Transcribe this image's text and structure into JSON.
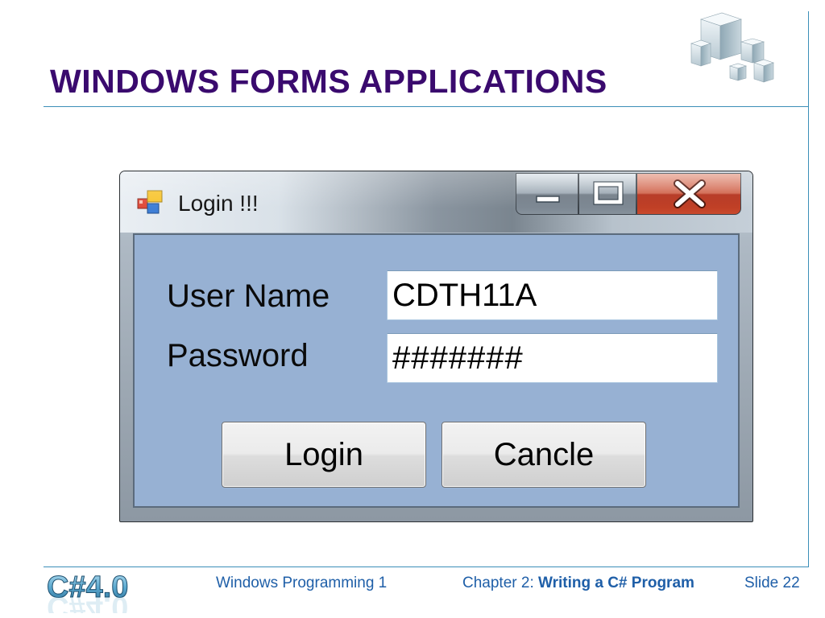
{
  "slide": {
    "title": "WINDOWS FORMS APPLICATIONS"
  },
  "window": {
    "title": "Login !!!",
    "icon": "winforms-app-icon",
    "controls": {
      "minimize_icon": "minimize-icon",
      "maximize_icon": "maximize-icon",
      "close_icon": "close-icon"
    },
    "form": {
      "username_label": "User Name",
      "username_value": "CDTH11A",
      "password_label": "Password",
      "password_value": "#######",
      "login_button": "Login",
      "cancel_button": "Cancle"
    },
    "colors": {
      "client_background": "#97b1d3",
      "close_button": "#c0392b"
    }
  },
  "footer": {
    "logo_text": "C#4.0",
    "course": "Windows Programming 1",
    "chapter_prefix": "Chapter 2: ",
    "chapter_title": "Writing a C# Program",
    "slide_number": "Slide 22"
  },
  "colors": {
    "title": "#3a0a6e",
    "footer_text": "#1f5fa8",
    "rule": "#3b8fb8"
  }
}
